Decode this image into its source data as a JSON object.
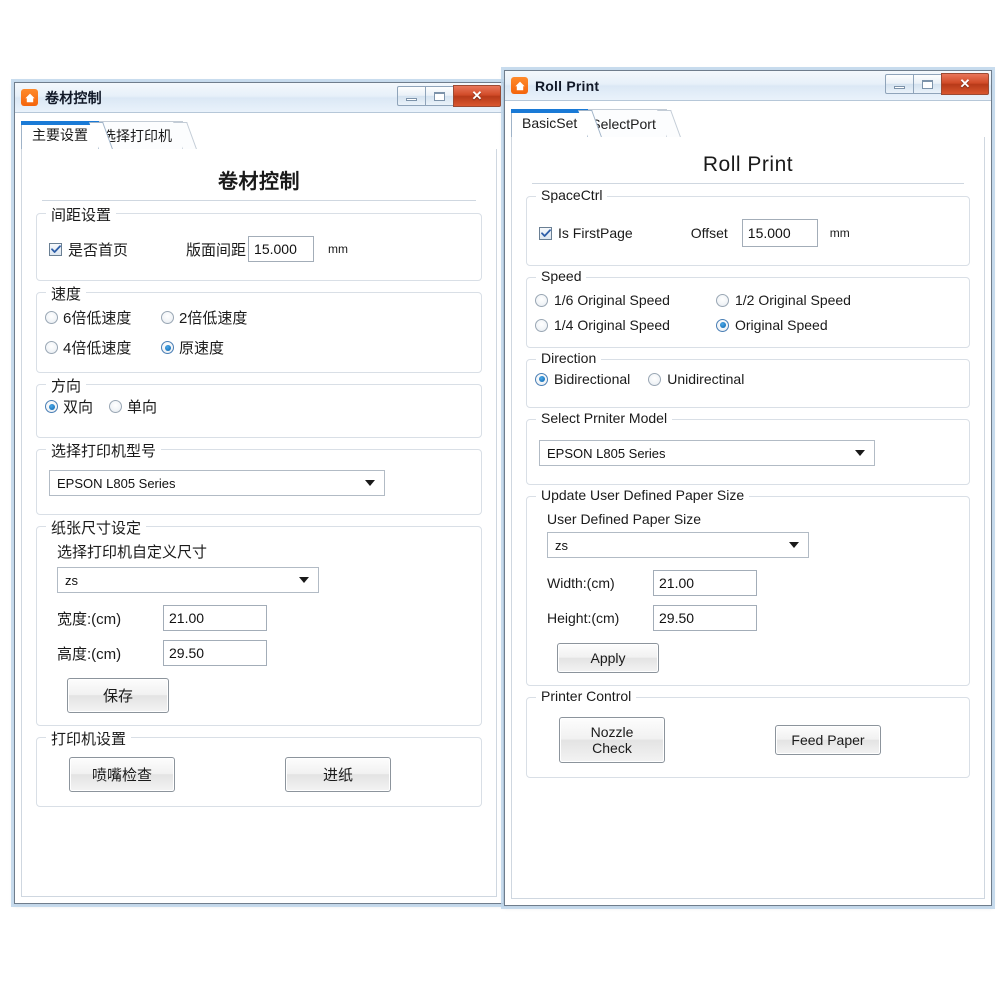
{
  "windows": {
    "left": {
      "title": "卷材控制",
      "app_icon": "house-icon",
      "controls": {
        "minimize": "minimize-icon",
        "maximize": "maximize-icon",
        "close": "✕"
      },
      "tabs": [
        {
          "label": "主要设置",
          "active": true
        },
        {
          "label": "选择打印机",
          "active": false
        }
      ],
      "page_heading": "卷材控制",
      "groups": {
        "spacing": {
          "title": "间距设置",
          "checkbox": {
            "label": "是否首页",
            "checked": true
          },
          "offset_label": "版面间距",
          "offset_value": "15.000",
          "unit": "mm"
        },
        "speed": {
          "title": "速度",
          "options": [
            {
              "label": "6倍低速度",
              "selected": false
            },
            {
              "label": "2倍低速度",
              "selected": false
            },
            {
              "label": "4倍低速度",
              "selected": false
            },
            {
              "label": "原速度",
              "selected": true
            }
          ]
        },
        "direction": {
          "title": "方向",
          "options": [
            {
              "label": "双向",
              "selected": true
            },
            {
              "label": "单向",
              "selected": false
            }
          ]
        },
        "printer_model": {
          "title": "选择打印机型号",
          "selected": "EPSON L805 Series"
        },
        "paper_size": {
          "title": "纸张尺寸设定",
          "subtitle": "选择打印机自定义尺寸",
          "preset": "zs",
          "width_label": "宽度:(cm)",
          "width_value": "21.00",
          "height_label": "高度:(cm)",
          "height_value": "29.50",
          "save_button": "保存"
        },
        "printer_control": {
          "title": "打印机设置",
          "nozzle_button": "喷嘴检查",
          "feed_button": "进纸"
        }
      }
    },
    "right": {
      "title": "Roll Print",
      "app_icon": "house-icon",
      "controls": {
        "minimize": "minimize-icon",
        "maximize": "maximize-icon",
        "close": "✕"
      },
      "tabs": [
        {
          "label": "BasicSet",
          "active": true
        },
        {
          "label": "SelectPort",
          "active": false
        }
      ],
      "page_heading": "Roll Print",
      "groups": {
        "spacing": {
          "title": "SpaceCtrl",
          "checkbox": {
            "label": "Is FirstPage",
            "checked": true
          },
          "offset_label": "Offset",
          "offset_value": "15.000",
          "unit": "mm"
        },
        "speed": {
          "title": "Speed",
          "options": [
            {
              "label": "1/6 Original Speed",
              "selected": false
            },
            {
              "label": "1/2 Original Speed",
              "selected": false
            },
            {
              "label": "1/4 Original Speed",
              "selected": false
            },
            {
              "label": "Original Speed",
              "selected": true
            }
          ]
        },
        "direction": {
          "title": "Direction",
          "options": [
            {
              "label": "Bidirectional",
              "selected": true
            },
            {
              "label": "Unidirectinal",
              "selected": false
            }
          ]
        },
        "printer_model": {
          "title": "Select Prniter Model",
          "selected": "EPSON L805 Series"
        },
        "paper_size": {
          "title": "Update User Defined Paper Size",
          "subtitle": "User Defined Paper Size",
          "preset": "zs",
          "width_label": "Width:(cm)",
          "width_value": "21.00",
          "height_label": "Height:(cm)",
          "height_value": "29.50",
          "save_button": "Apply"
        },
        "printer_control": {
          "title": "Printer Control",
          "nozzle_button": "Nozzle Check",
          "feed_button": "Feed Paper"
        }
      }
    }
  },
  "colors": {
    "accent_tab": "#1a7ad6",
    "close_button": "#c1401c",
    "app_icon": "#f4640c",
    "radio_on": "#0a63ad",
    "window_border": "#6f7d8c"
  }
}
